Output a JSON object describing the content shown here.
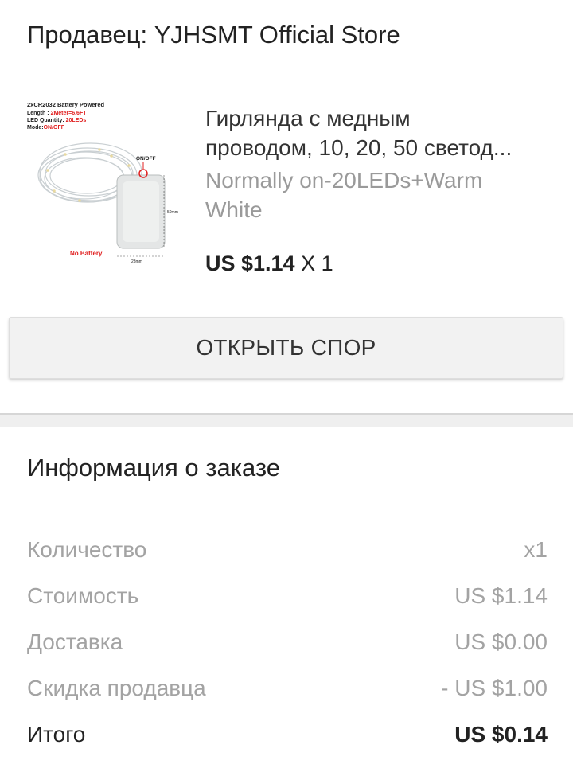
{
  "seller": {
    "text": "Продавец: YJHSMT Official Store"
  },
  "product": {
    "image_text": {
      "line1": "2xCR2032 Battery Powered",
      "line2_label": "Length : ",
      "line2_value": "2Meter=6.6FT",
      "line3_label": "LED Quantity: ",
      "line3_value": "20LEDs",
      "line4_label": "Mode:",
      "line4_value": "ON/OFF",
      "onoff": "ON/OFF",
      "height": "50mm",
      "width": "23mm",
      "no_battery": "No Battery"
    },
    "title_line1": "Гирлянда с медным",
    "title_line2": "проводом, 10, 20, 50 светод...",
    "variant": "Normally on-20LEDs+Warm White",
    "price": "US $1.14",
    "quantity": "X 1"
  },
  "dispute_button": {
    "label": "ОТКРЫТЬ СПОР"
  },
  "order_info": {
    "title": "Информация о заказе",
    "rows": [
      {
        "label": "Количество",
        "value": "x1"
      },
      {
        "label": "Стоимость",
        "value": "US $1.14"
      },
      {
        "label": "Доставка",
        "value": "US $0.00"
      },
      {
        "label": "Скидка продавца",
        "value": "- US $1.00"
      }
    ],
    "total": {
      "label": "Итого",
      "value": "US $0.14"
    }
  },
  "colors": {
    "text": "#222222",
    "muted": "#a3a3a3",
    "button_bg": "#f2f2f2",
    "red_accent": "#e02020"
  }
}
